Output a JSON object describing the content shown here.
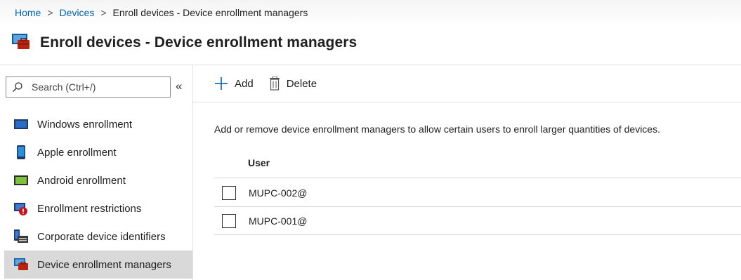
{
  "breadcrumb": {
    "home": "Home",
    "devices": "Devices",
    "current": "Enroll devices - Device enrollment managers",
    "separator": ">"
  },
  "header": {
    "title": "Enroll devices - Device enrollment managers",
    "icon": "device-enrollment-manager-icon"
  },
  "sidebar": {
    "search_placeholder": "Search (Ctrl+/)",
    "collapse_label": "«",
    "items": [
      {
        "label": "Windows enrollment",
        "icon": "windows-device-icon"
      },
      {
        "label": "Apple enrollment",
        "icon": "apple-device-icon"
      },
      {
        "label": "Android enrollment",
        "icon": "android-device-icon"
      },
      {
        "label": "Enrollment restrictions",
        "icon": "restriction-icon"
      },
      {
        "label": "Corporate device identifiers",
        "icon": "corporate-identifier-icon"
      },
      {
        "label": "Device enrollment managers",
        "icon": "device-enrollment-manager-icon",
        "active": true
      }
    ]
  },
  "toolbar": {
    "add_label": "Add",
    "delete_label": "Delete"
  },
  "content": {
    "description": "Add or remove device enrollment managers to allow certain users to enroll larger quantities of devices.",
    "columns": [
      "User"
    ],
    "rows": [
      {
        "user": "MUPC-002@"
      },
      {
        "user": "MUPC-001@"
      }
    ]
  },
  "colors": {
    "link": "#0063b1",
    "active_nav": "#d9d9d9",
    "accent": "#0063b1"
  }
}
